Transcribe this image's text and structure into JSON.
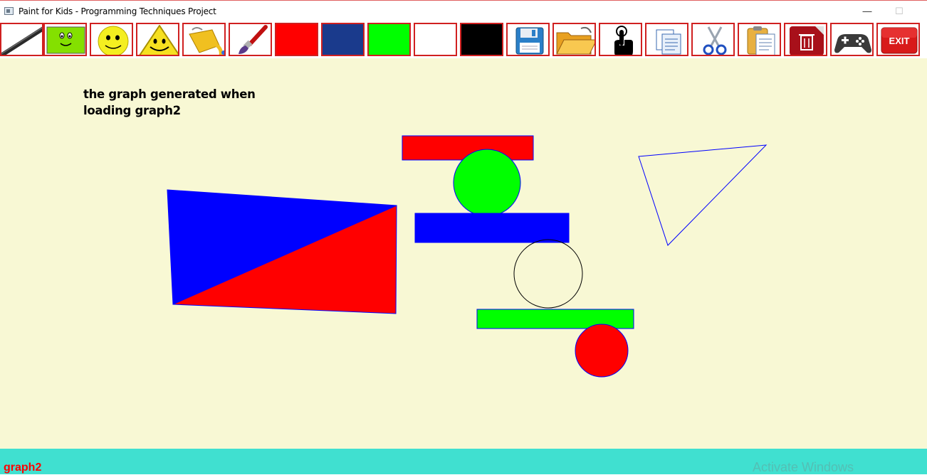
{
  "window": {
    "title": "Paint for Kids - Programming Techniques Project",
    "minimize_glyph": "—",
    "maximize_glyph": "☐"
  },
  "toolbar": {
    "tools": [
      {
        "name": "line-tool",
        "icon": "line-icon"
      },
      {
        "name": "rectangle-tool",
        "icon": "green-rectangle-smiley-icon"
      },
      {
        "name": "circle-tool",
        "icon": "yellow-circle-smiley-icon"
      },
      {
        "name": "triangle-tool",
        "icon": "yellow-triangle-smiley-icon"
      },
      {
        "name": "fill-tool",
        "icon": "paint-bucket-icon"
      },
      {
        "name": "brush-tool",
        "icon": "paintbrush-icon"
      },
      {
        "name": "color-red",
        "color": "#ff0000"
      },
      {
        "name": "color-dark-blue",
        "color": "#1a3a8c"
      },
      {
        "name": "color-green",
        "color": "#00ff00"
      },
      {
        "name": "color-white",
        "color": "#ffffff"
      },
      {
        "name": "color-black",
        "color": "#000000"
      },
      {
        "name": "save-tool",
        "icon": "floppy-disk-icon"
      },
      {
        "name": "load-tool",
        "icon": "open-folder-icon"
      },
      {
        "name": "select-tool",
        "icon": "hand-pointer-icon"
      },
      {
        "name": "copy-tool",
        "icon": "copy-icon"
      },
      {
        "name": "cut-tool",
        "icon": "scissors-icon"
      },
      {
        "name": "paste-tool",
        "icon": "paste-clipboard-icon"
      },
      {
        "name": "delete-tool",
        "icon": "trash-icon"
      },
      {
        "name": "play-mode-tool",
        "icon": "gamepad-icon"
      },
      {
        "name": "exit-tool",
        "icon": "exit-icon",
        "label": "EXIT"
      }
    ]
  },
  "canvas": {
    "caption_line1": "the graph generated when",
    "caption_line2": "loading graph2",
    "background": "#f8f8d4"
  },
  "statusbar": {
    "message": "graph2",
    "watermark": "Activate Windows",
    "background": "#40e0d0",
    "message_color": "#ff0000"
  }
}
